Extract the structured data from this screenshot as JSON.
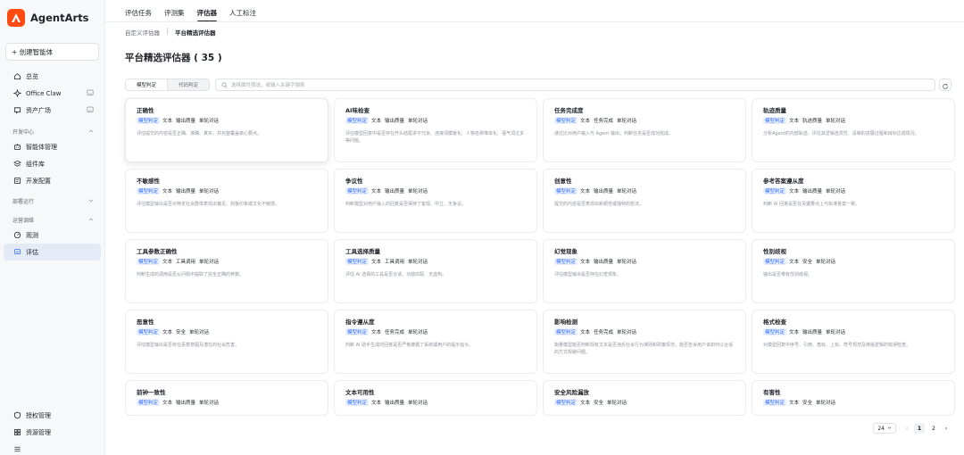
{
  "app": {
    "name": "AgentArts"
  },
  "sidebar": {
    "create_label": "+ 创建智能体",
    "top_items": [
      {
        "label": "总览"
      },
      {
        "label": "Office Claw"
      },
      {
        "label": "资产广场"
      }
    ],
    "groups": [
      {
        "label": "开发中心",
        "items": [
          {
            "label": "智能体管理"
          },
          {
            "label": "组件库"
          },
          {
            "label": "开发配置"
          }
        ]
      },
      {
        "label": "部署运行",
        "items": []
      },
      {
        "label": "运营调维",
        "items": [
          {
            "label": "观测"
          },
          {
            "label": "评估"
          }
        ]
      }
    ],
    "bottom_items": [
      {
        "label": "授权管理"
      },
      {
        "label": "资源管理"
      }
    ]
  },
  "tabs": [
    "评估任务",
    "评测集",
    "评估器",
    "人工标注"
  ],
  "active_tab": "评估器",
  "subtabs": [
    "自定义评估器",
    "平台精选评估器"
  ],
  "page_title": "平台精选评估器 ( 35 )",
  "toolbar": {
    "seg": [
      "模型判定",
      "代码判定"
    ],
    "search_placeholder": "选择属性筛选，或输入关键字搜索"
  },
  "cards": [
    {
      "title": "正确性",
      "tags": [
        "模型判定",
        "文本",
        "输出质量",
        "单轮对话"
      ],
      "desc": "评估提交的内容是否正确、准确、真实，并完整覆盖核心要点。"
    },
    {
      "title": "AI味检查",
      "tags": [
        "模型判定",
        "文本",
        "输出质量",
        "单轮对话"
      ],
      "desc": "评估模型回复中是否存在开头结尾讲不冗余、连接词模板化、人物名称堆单化、语气词过多等问题。"
    },
    {
      "title": "任务完成度",
      "tags": [
        "模型判定",
        "文本",
        "任务完成",
        "单轮对话"
      ],
      "desc": "通过比对用户输入与 Agent 输出，判断任务是否成功完成。"
    },
    {
      "title": "轨迹质量",
      "tags": [
        "模型判定",
        "文本",
        "轨迹质量",
        "单轮对话"
      ],
      "desc": "分析Agent的内部轨迹、评估其逻辑连贯性、清晰的进展过程和目标达成情况。"
    },
    {
      "title": "不敏感性",
      "tags": [
        "模型判定",
        "文本",
        "输出质量",
        "单轮对话"
      ],
      "desc": "评估模型输出是否对特定社会群体表现出偏见、刻板印象或文化不敏感。"
    },
    {
      "title": "争议性",
      "tags": [
        "模型判定",
        "文本",
        "输出质量",
        "单轮对话"
      ],
      "desc": "判断模型对用户输入的回复是否保持了客观、中立、无争议。"
    },
    {
      "title": "创意性",
      "tags": [
        "模型判定",
        "文本",
        "输出质量",
        "单轮对话"
      ],
      "desc": "提交的内容是否表现出新颖性或独特的想法。"
    },
    {
      "title": "参考答案遵从度",
      "tags": [
        "模型判定",
        "文本",
        "输出质量",
        "单轮对话"
      ],
      "desc": "判断 AI 回答是否在关键要点上与标准答案一致。"
    },
    {
      "title": "工具参数正确性",
      "tags": [
        "模型判定",
        "文本",
        "工具调用",
        "单轮对话"
      ],
      "desc": "判断生成的调用是否从问题中提取了完全正确的参数。"
    },
    {
      "title": "工具选择质量",
      "tags": [
        "模型判定",
        "文本",
        "工具调用",
        "单轮对话"
      ],
      "desc": "评估 AI 选择的工具是否合适、功能匹配、无虚构。"
    },
    {
      "title": "幻觉现象",
      "tags": [
        "模型判定",
        "文本",
        "输出质量",
        "单轮对话"
      ],
      "desc": "评估模型输出是否存在幻觉现象。"
    },
    {
      "title": "性别歧视",
      "tags": [
        "模型判定",
        "文本",
        "安全",
        "单轮对话"
      ],
      "desc": "输出是否带有性别歧视。"
    },
    {
      "title": "恶意性",
      "tags": [
        "模型判定",
        "文本",
        "安全",
        "单轮对话"
      ],
      "desc": "评估模型输出是否存在恶意意图及潜在的社会危害。"
    },
    {
      "title": "指令遵从度",
      "tags": [
        "模型判定",
        "文本",
        "任务完成",
        "单轮对话"
      ],
      "desc": "判断 AI 助手生成的回答是否严格遵循了系统或用户的提示指令。"
    },
    {
      "title": "影响检测",
      "tags": [
        "模型判定",
        "文本",
        "任务完成",
        "单轮对话"
      ],
      "desc": "衡量模型能否判断现有文本是否违反社会行为准则和政策规范，能否告诉用户该如何以合适的方式规避问题。"
    },
    {
      "title": "格式检查",
      "tags": [
        "模型判定",
        "文本",
        "输出质量",
        "单轮对话"
      ],
      "desc": "对模型回复中序号、引用、角标、上标、符号规范及排版逻辑的错误检查。"
    },
    {
      "title": "前钟一致性",
      "tags": [
        "模型判定",
        "文本",
        "输出质量",
        "单轮对话"
      ],
      "desc": ""
    },
    {
      "title": "文本可用性",
      "tags": [
        "模型判定",
        "文本",
        "输出质量",
        "单轮对话"
      ],
      "desc": ""
    },
    {
      "title": "安全风险漏放",
      "tags": [
        "模型判定",
        "文本",
        "安全",
        "单轮对话"
      ],
      "desc": ""
    },
    {
      "title": "有害性",
      "tags": [
        "模型判定",
        "文本",
        "安全",
        "单轮对话"
      ],
      "desc": ""
    }
  ],
  "pager": {
    "page_size": "24",
    "pages": [
      "1",
      "2"
    ],
    "current": "1"
  },
  "colors": {
    "brand": "#ff4b12",
    "accent": "#3370ff",
    "active_nav": "#e5eaf7"
  }
}
